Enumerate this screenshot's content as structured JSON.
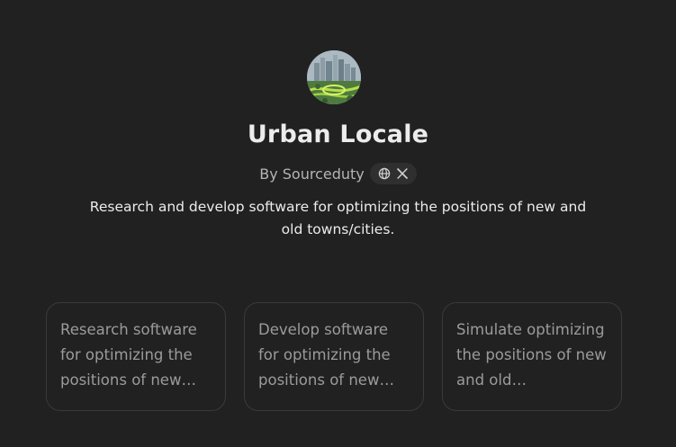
{
  "gpt": {
    "name": "Urban Locale",
    "author": "By Sourceduty",
    "description": "Research and develop software for optimizing the positions of new and old towns/cities."
  },
  "links": {
    "website_icon": "globe-icon",
    "social_icon": "x-logo-icon"
  },
  "starters": [
    {
      "text": "Research software for optimizing the positions of new and old towns/cities."
    },
    {
      "text": "Develop software for optimizing the positions of new and old towns/cities."
    },
    {
      "text": "Simulate optimizing the positions of new and old towns/cities."
    }
  ],
  "colors": {
    "background": "#212121",
    "card_border": "#3a3a3a",
    "muted_text": "#9b9b9b"
  }
}
